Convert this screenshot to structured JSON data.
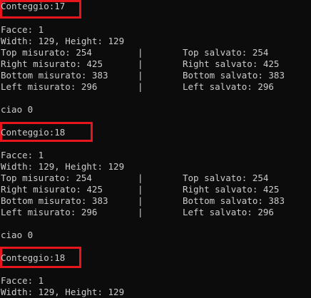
{
  "console": {
    "blocks": [
      {
        "counter": "Conteggio:17",
        "faces": "Facce: 1",
        "size": "Width: 129, Height: 129",
        "rows": [
          {
            "left": "Top misurato: 254",
            "sep": "|",
            "right": "Top salvato: 254"
          },
          {
            "left": "Right misurato: 425",
            "sep": "|",
            "right": "Right salvato: 425"
          },
          {
            "left": "Bottom misurato: 383",
            "sep": "|",
            "right": "Bottom salvato: 383"
          },
          {
            "left": "Left misurato: 296",
            "sep": "|",
            "right": "Left salvato: 296"
          }
        ],
        "footer": "ciao 0"
      },
      {
        "counter": "Conteggio:18",
        "faces": "Facce: 1",
        "size": "Width: 129, Height: 129",
        "rows": [
          {
            "left": "Top misurato: 254",
            "sep": "|",
            "right": "Top salvato: 254"
          },
          {
            "left": "Right misurato: 425",
            "sep": "|",
            "right": "Right salvato: 425"
          },
          {
            "left": "Bottom misurato: 383",
            "sep": "|",
            "right": "Bottom salvato: 383"
          },
          {
            "left": "Left misurato: 296",
            "sep": "|",
            "right": "Left salvato: 296"
          }
        ],
        "footer": "ciao 0"
      },
      {
        "counter": "Conteggio:18",
        "faces": "Facce: 1",
        "size": "Width: 129, Height: 129"
      }
    ],
    "colors": {
      "background": "#0c0c0c",
      "text": "#cccccc",
      "highlight": "#e8141e"
    }
  }
}
